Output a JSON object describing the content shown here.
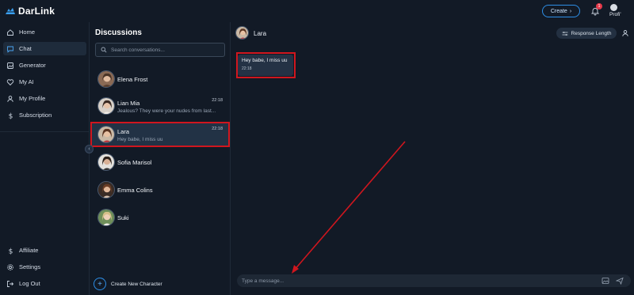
{
  "app": {
    "logo_text": "DarLink",
    "create_label": "Create",
    "notification_count": "1",
    "profile_label": "Profi'"
  },
  "sidebar": {
    "items": [
      {
        "label": "Home",
        "icon": "home-icon"
      },
      {
        "label": "Chat",
        "icon": "chat-icon",
        "active": true
      },
      {
        "label": "Generator",
        "icon": "generator-icon"
      },
      {
        "label": "My AI",
        "icon": "heart-icon"
      },
      {
        "label": "My Profile",
        "icon": "user-icon"
      },
      {
        "label": "Subscription",
        "icon": "dollar-icon"
      }
    ],
    "bottom_items": [
      {
        "label": "Affiliate",
        "icon": "dollar-icon"
      },
      {
        "label": "Settings",
        "icon": "gear-icon"
      },
      {
        "label": "Log Out",
        "icon": "logout-icon"
      }
    ]
  },
  "discussions": {
    "title": "Discussions",
    "search_placeholder": "Search conversations...",
    "conversations": [
      {
        "name": "Elena Frost",
        "preview": "",
        "time": ""
      },
      {
        "name": "Lian Mia",
        "preview": "Jealous? They were your nudes from last...",
        "time": "22:18"
      },
      {
        "name": "Lara",
        "preview": "Hey babe, I miss uu",
        "time": "22:18",
        "selected": true
      },
      {
        "name": "Sofia Marisol",
        "preview": "",
        "time": ""
      },
      {
        "name": "Emma Colins",
        "preview": "",
        "time": ""
      },
      {
        "name": "Suki",
        "preview": "",
        "time": ""
      }
    ],
    "create_label": "Create New Character"
  },
  "chat": {
    "contact_name": "Lara",
    "response_length_label": "Response Length",
    "messages": [
      {
        "text": "Hey babe, I miss uu",
        "time": "22:18"
      }
    ],
    "input_placeholder": "Type a message..."
  },
  "colors": {
    "background": "#121a26",
    "accent": "#2d8ee6",
    "highlight": "#d0161e",
    "badge": "#e5394a"
  }
}
